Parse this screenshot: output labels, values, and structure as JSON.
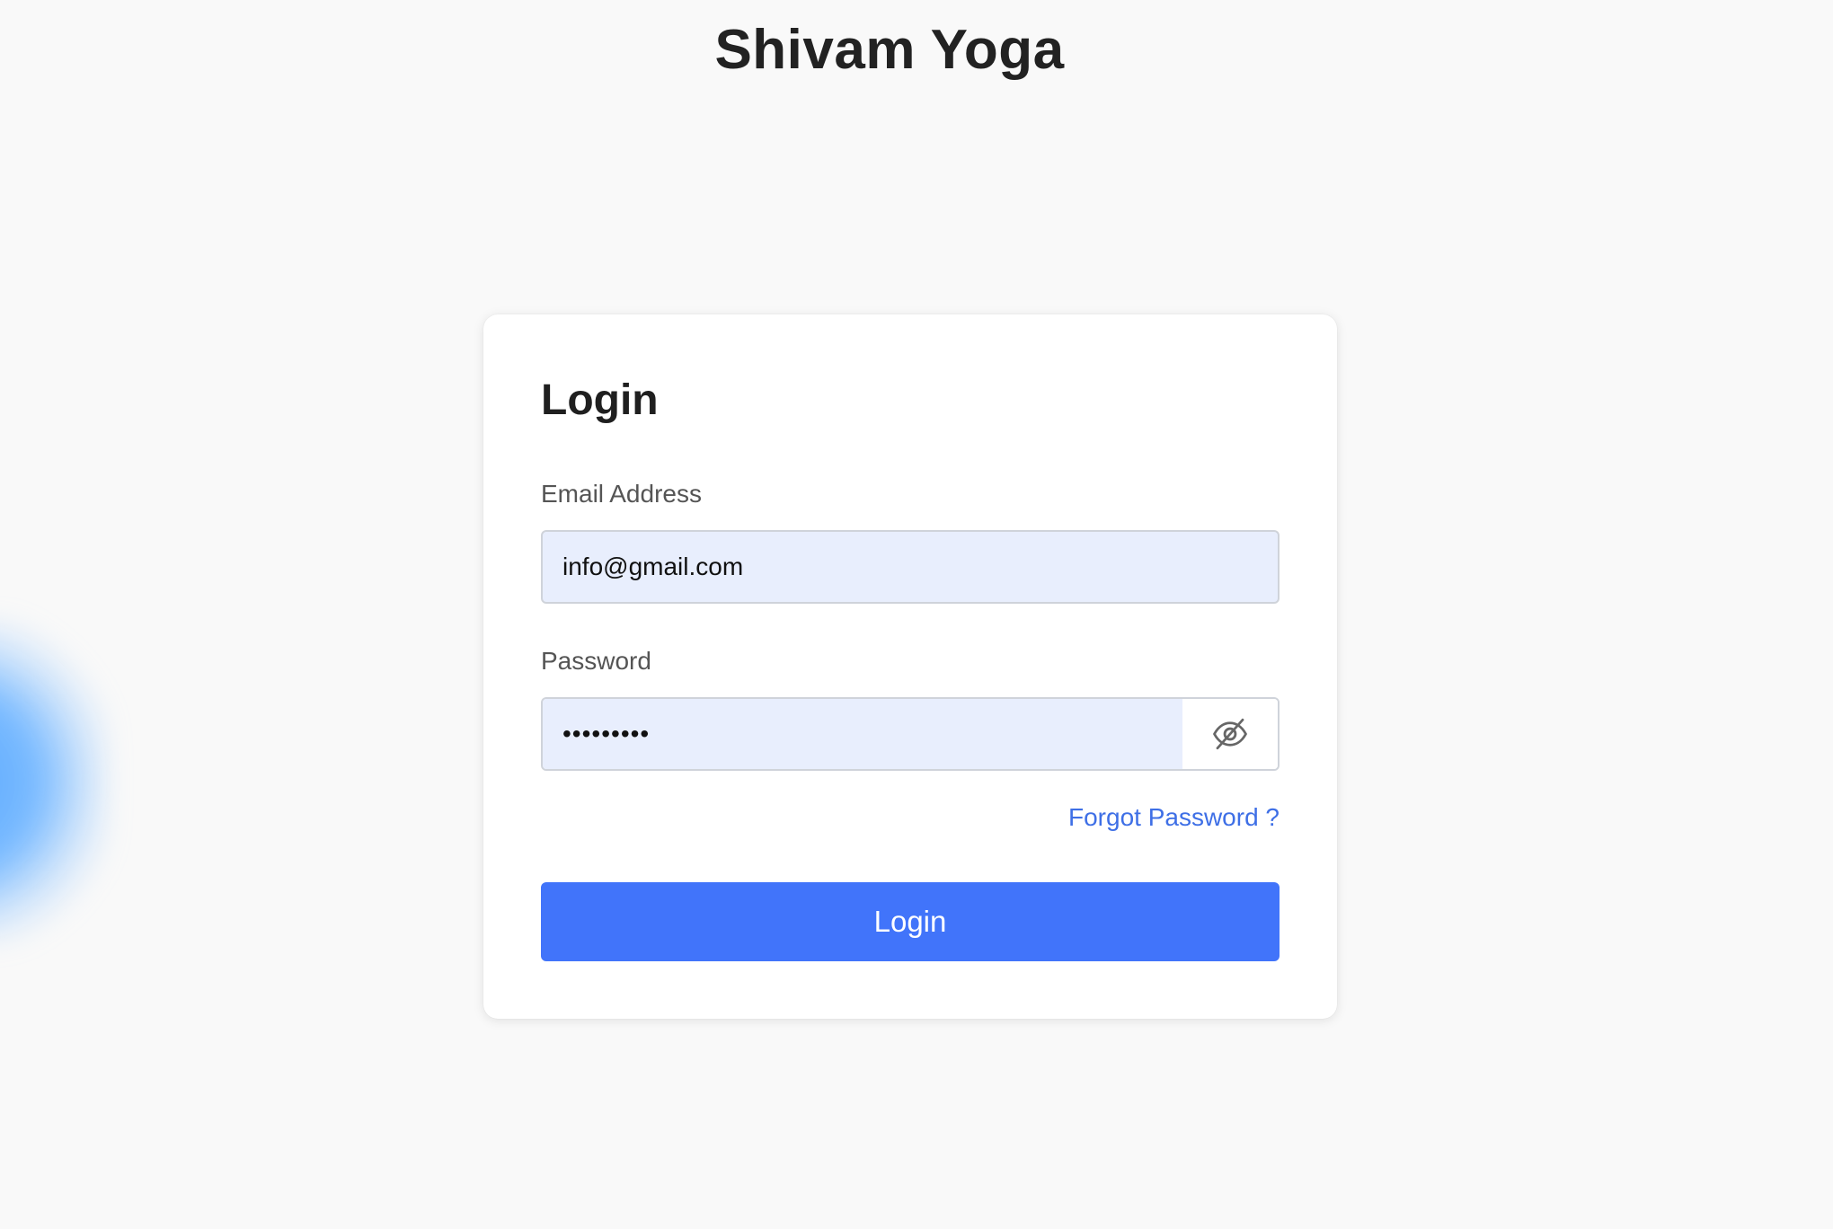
{
  "header": {
    "brand_title": "Shivam Yoga"
  },
  "login_card": {
    "title": "Login",
    "email": {
      "label": "Email Address",
      "value": "info@gmail.com"
    },
    "password": {
      "label": "Password",
      "masked_value": "•••••••••",
      "toggle_icon": "eye-slash-icon"
    },
    "forgot_password_link": "Forgot Password ?",
    "submit_label": "Login"
  },
  "colors": {
    "primary": "#4174fa",
    "link": "#3e6fe6",
    "input_fill": "#e8eefd",
    "page_background": "#f9f9f9"
  }
}
